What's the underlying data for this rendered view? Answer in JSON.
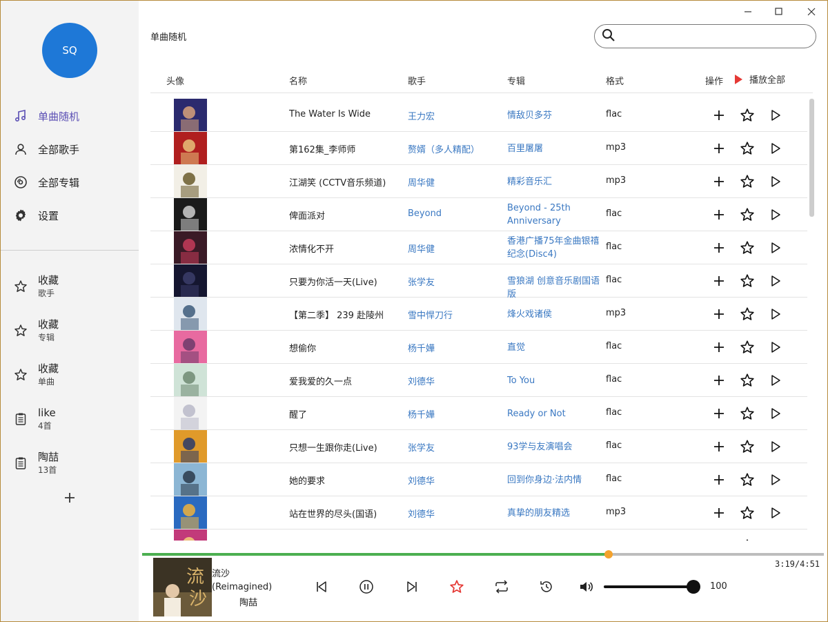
{
  "user": {
    "initials": "SQ"
  },
  "nav": [
    {
      "label": "单曲随机",
      "icon": "music-note-icon",
      "active": true
    },
    {
      "label": "全部歌手",
      "icon": "person-icon",
      "active": false
    },
    {
      "label": "全部专辑",
      "icon": "disc-icon",
      "active": false
    },
    {
      "label": "设置",
      "icon": "gear-icon",
      "active": false
    }
  ],
  "favorites": [
    {
      "title": "收藏",
      "sub": "歌手",
      "icon": "star-outline-icon"
    },
    {
      "title": "收藏",
      "sub": "专辑",
      "icon": "star-outline-icon"
    },
    {
      "title": "收藏",
      "sub": "单曲",
      "icon": "star-outline-icon"
    },
    {
      "title": "like",
      "sub": "4首",
      "icon": "playlist-icon"
    },
    {
      "title": "陶喆",
      "sub": "13首",
      "icon": "playlist-icon"
    }
  ],
  "page": {
    "title": "单曲随机"
  },
  "search": {
    "placeholder": "",
    "value": ""
  },
  "table": {
    "headers": {
      "cover": "头像",
      "name": "名称",
      "artist": "歌手",
      "album": "专辑",
      "format": "格式",
      "ops": "操作",
      "play_all": "播放全部"
    },
    "rows": [
      {
        "name": "The Water Is Wide",
        "artist": "王力宏",
        "album": "情敌贝多芬",
        "format": "flac",
        "cover_colors": [
          "#2b2a6e",
          "#d9a27a"
        ]
      },
      {
        "name": "第162集_李师师",
        "artist": "赘婿（多人精配）",
        "album": "百里屠屠",
        "format": "mp3",
        "cover_colors": [
          "#b01f1f",
          "#e8c27a"
        ]
      },
      {
        "name": "江湖笑 (CCTV音乐频道)",
        "artist": "周华健",
        "album": "精彩音乐汇",
        "format": "mp3",
        "cover_colors": [
          "#f2efe6",
          "#6a5a2a"
        ]
      },
      {
        "name": "俾面派对",
        "artist": "Beyond",
        "album": "Beyond - 25th Anniversary",
        "format": "flac",
        "cover_colors": [
          "#1a1a1a",
          "#cfcfcf"
        ]
      },
      {
        "name": "浓情化不开",
        "artist": "周华健",
        "album": "香港广播75年金曲银禧纪念(Disc4)",
        "format": "flac",
        "cover_colors": [
          "#3a1a26",
          "#c63c5a"
        ]
      },
      {
        "name": "只要为你活一天(Live)",
        "artist": "张学友",
        "album": "雪狼湖 创意音乐剧国语版",
        "format": "flac",
        "cover_colors": [
          "#151630",
          "#3b3d6a"
        ]
      },
      {
        "name": "【第二季】 239 赴陵州",
        "artist": "雪中悍刀行",
        "album": "烽火戏诸侯",
        "format": "mp3",
        "cover_colors": [
          "#dfe6ee",
          "#3d5a7a"
        ]
      },
      {
        "name": "想偷你",
        "artist": "杨千嬅",
        "album": "直觉",
        "format": "flac",
        "cover_colors": [
          "#e86aa0",
          "#6b3a6a"
        ]
      },
      {
        "name": "爱我爱的久一点",
        "artist": "刘德华",
        "album": "To You",
        "format": "flac",
        "cover_colors": [
          "#cfe3d7",
          "#6f8a72"
        ]
      },
      {
        "name": "醒了",
        "artist": "杨千嬅",
        "album": "Ready or Not",
        "format": "flac",
        "cover_colors": [
          "#f3f3f3",
          "#b8b8c8"
        ]
      },
      {
        "name": "只想一生跟你走(Live)",
        "artist": "张学友",
        "album": "93学与友演唱会",
        "format": "flac",
        "cover_colors": [
          "#e09a2a",
          "#2a3a6a"
        ]
      },
      {
        "name": "她的要求",
        "artist": "刘德华",
        "album": "回到你身边·法内情",
        "format": "flac",
        "cover_colors": [
          "#8cb6d4",
          "#2a3a4a"
        ]
      },
      {
        "name": "站在世界的尽头(国语)",
        "artist": "刘德华",
        "album": "真挚的朋友精选",
        "format": "mp3",
        "cover_colors": [
          "#2a6ac0",
          "#f0b23a"
        ]
      },
      {
        "name": "",
        "artist": "",
        "album": "",
        "format": "",
        "cover_colors": [
          "#c23a7a",
          "#f4d27a"
        ]
      }
    ]
  },
  "player": {
    "title": "流沙 (Reimagined)",
    "title_line1": "流沙",
    "title_line2": "(Reimagined)",
    "artist": "陶喆",
    "time": "3:19/4:51",
    "progress": 0.6838,
    "volume": 100,
    "volume_label": "100",
    "favorited": true,
    "accent": "#4caf50",
    "knob_color": "#f4a22c",
    "fav_color": "#e53935"
  }
}
